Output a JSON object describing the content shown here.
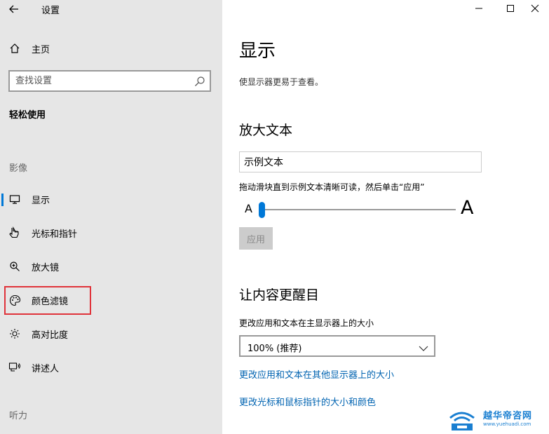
{
  "window": {
    "title": "设置",
    "minimize_icon": "minimize-icon",
    "maximize_icon": "maximize-icon",
    "close_icon": "close-icon"
  },
  "sidebar": {
    "home": {
      "label": "主页",
      "icon": "home-icon"
    },
    "search": {
      "placeholder": "查找设置",
      "icon": "search-icon"
    },
    "category": "轻松使用",
    "group_vision": "影像",
    "items": [
      {
        "label": "显示",
        "icon": "monitor-icon",
        "selected": true
      },
      {
        "label": "光标和指针",
        "icon": "pointer-icon",
        "selected": false
      },
      {
        "label": "放大镜",
        "icon": "magnifier-icon",
        "selected": false
      },
      {
        "label": "颜色滤镜",
        "icon": "palette-icon",
        "selected": false
      },
      {
        "label": "高对比度",
        "icon": "brightness-icon",
        "selected": false
      },
      {
        "label": "讲述人",
        "icon": "narrator-icon",
        "selected": false
      }
    ],
    "group_hearing": "听力"
  },
  "main": {
    "title": "显示",
    "subtitle": "使显示器更易于查看。",
    "section_text": {
      "title": "放大文本",
      "sample": "示例文本",
      "hint": "拖动滑块直到示例文本清晰可读，然后单击“应用”",
      "small_a": "A",
      "large_a": "A",
      "slider_value_fraction": 0.0,
      "apply_label": "应用"
    },
    "section_content": {
      "title": "让内容更醒目",
      "scale_label": "更改应用和文本在主显示器上的大小",
      "scale_value": "100% (推荐)",
      "link_other_displays": "更改应用和文本在其他显示器上的大小",
      "link_cursor": "更改光标和鼠标指针的大小和颜色"
    }
  },
  "colors": {
    "accent": "#0078d7",
    "highlight_border": "#e0333a",
    "link": "#0063b1",
    "sidebar_bg": "#e6e6e6"
  },
  "watermark": {
    "text": "越华帝咨网",
    "url": "www.yuehuadi.com"
  }
}
